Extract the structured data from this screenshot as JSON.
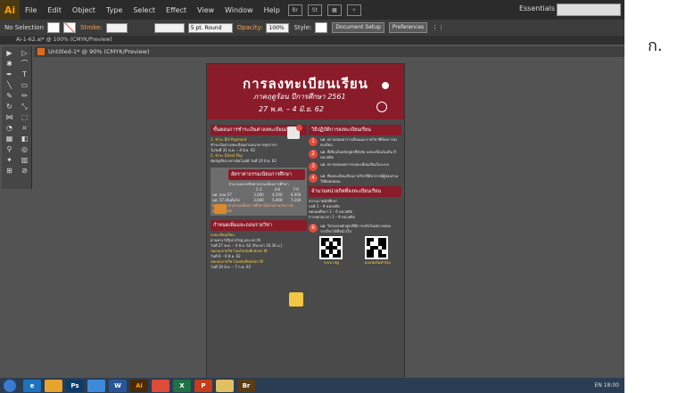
{
  "app": {
    "logo": "Ai",
    "menu": [
      "File",
      "Edit",
      "Object",
      "Type",
      "Select",
      "Effect",
      "View",
      "Window",
      "Help"
    ],
    "workspace": "Essentials",
    "accent": "#ff9a00"
  },
  "control_bar": {
    "selection": "No Selection",
    "stroke_label": "Stroke:",
    "brush": "5 pt. Round",
    "opacity_label": "Opacity:",
    "opacity_value": "100%",
    "style_label": "Style:",
    "document_setup": "Document Setup",
    "preferences": "Preferences"
  },
  "tabs": {
    "panel_tab": "Ai-1-62.ai* @ 100% (CMYK/Preview)",
    "doc_tab": "Untitled-1* @ 90% (CMYK/Preview)"
  },
  "poster": {
    "title": "การลงทะเบียนเรียน",
    "subtitle": "ภาคฤดูร้อน ปีการศึกษา 2561",
    "date": "27 พ.ค. – 4 มิ.ย. 62",
    "left": {
      "payment_header": "ขั้นตอนการชำระเงินค่าลงทะเบียนเรียน",
      "payment_text": [
        "1. ชำระ Bill Payment",
        "ชำระเงินค่าลงทะเบียนผ่านธนาคารทุกสาขา",
        "ในวันที่ 31 พ.ค. – 4 มิ.ย. 62",
        "2. ชำระ Direct Pay",
        "ตัดบัญชีธนาคารอัตโนมัติ วันที่ 10 มิ.ย. 62"
      ],
      "fee_header": "อัตราค่าธรรมเนียมการศึกษา",
      "fee_caption": "จำนวนหน่วยกิตค่าธรรมเนียมการศึกษา",
      "fee_cols": [
        "",
        "1-3",
        "4-6",
        "7-9"
      ],
      "fee_rows": [
        [
          "นศ. ก่อน 57",
          "3,000",
          "4,500",
          "6,000"
        ],
        [
          "นศ. 57 เป็นต้นไป",
          "3,600",
          "5,400",
          "7,200"
        ]
      ],
      "fee_note": "หมายเหตุ ค่าธรรมเนียมการศึกษาเป็นไปตามประกาศมหาวิทยาลัย",
      "schedule_header": "กำหนดเพิ่มและถอนรายวิชา",
      "schedule_text": [
        "ลงทะเบียนเรียน",
        "ผ่านทาง https://reg.psu.ac.th",
        "วันที่ 27 พ.ค. – 4 มิ.ย. 62 (ถึงเวลา 16.30 น.)",
        "ขอถอนรายวิชาโดยไม่บันทึกอักษร W",
        "วันที่ 6 – 9 มิ.ย. 62",
        "ขอถอนรายวิชาโดยบันทึกอักษร W",
        "วันที่ 10 มิ.ย. – 7 ก.ค. 62"
      ]
    },
    "right": {
      "procedure_header": "วิธีปฏิบัติการลงทะเบียนเรียน",
      "steps": [
        {
          "n": "1",
          "text": "นศ. ตรวจสอบตารางเรียนและรายวิชาที่ต้องการลงทะเบียน"
        },
        {
          "n": "2",
          "text": "นศ. ที่เรียนในหลักสูตรที่สังกัด ลงทะเบียนไม่เกิน 9 หน่วยกิต"
        },
        {
          "n": "3",
          "text": "นศ. ตรวจสอบผลการลงทะเบียนเรียนในระบบ"
        },
        {
          "n": "4",
          "text": "นศ. ที่ลงทะเบียนเรียนรายวิชาที่มีอาจารย์ผู้สอนร่วม ให้ติดต่อคณะ"
        }
      ],
      "credit_header": "จำนวนหน่วยกิตที่ลงทะเบียนเรียน",
      "credit_lines": [
        "สถานภาพนักศึกษา",
        "ปกติ 1 – 9 หน่วยกิต",
        "ทดลองศึกษา 1 – 6 หน่วยกิต",
        "การขยายเวลา 1 – 9 หน่วยกิต"
      ],
      "final_step": {
        "n": "6",
        "text": "นศ. วิชาเอกหลักสูตรที่มีการปรับใหม่ตรวจสอบรายวิชาได้ที่หน้าเว็บ"
      },
      "qr_labels": [
        "ระบบ reg",
        "แบบฟอร์มคำร้อง"
      ]
    }
  },
  "taskbar": {
    "apps": [
      "e",
      "",
      "Ps",
      "",
      "W",
      "Ai",
      "",
      "X",
      "P",
      "",
      "Br"
    ],
    "tray": "EN 18:00"
  },
  "thai_label": "ก."
}
